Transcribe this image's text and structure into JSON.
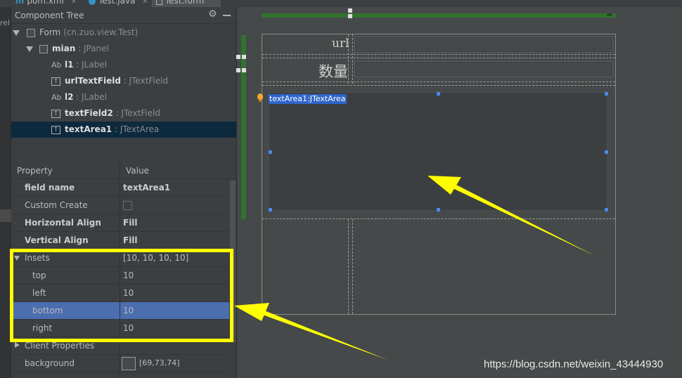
{
  "tabs": [
    {
      "label": "pom.xml",
      "icon": "maven-icon"
    },
    {
      "label": "Test.java",
      "icon": "java-class-icon"
    },
    {
      "label": "Test.form",
      "icon": "form-icon"
    }
  ],
  "left_strip_text": "rel",
  "component_tree": {
    "title": "Component Tree",
    "items": [
      {
        "name": "Form",
        "type": "(cn.zuo.view.Test)",
        "expanded": true,
        "has_checkbox": true
      },
      {
        "name": "mian",
        "type": ": JPanel",
        "expanded": true,
        "has_checkbox": true
      },
      {
        "icon_text": "Ab",
        "name": "l1",
        "type": ": JLabel"
      },
      {
        "icon_text": "T",
        "name": "urlTextField",
        "type": ": JTextField"
      },
      {
        "icon_text": "Ab",
        "name": "l2",
        "type": ": JLabel"
      },
      {
        "icon_text": "T",
        "name": "textField2",
        "type": ": JTextField"
      },
      {
        "icon_text": "T",
        "name": "textArea1",
        "type": ": JTextArea",
        "selected": true
      }
    ]
  },
  "properties": {
    "header_property": "Property",
    "header_value": "Value",
    "rows": [
      {
        "name": "field name",
        "value": "textArea1",
        "bold": true
      },
      {
        "name": "Custom Create",
        "value": "",
        "checkbox": true
      },
      {
        "name": "Horizontal Align",
        "value": "Fill",
        "bold": true
      },
      {
        "name": "Vertical Align",
        "value": "Fill",
        "bold": true
      },
      {
        "name": "Insets",
        "value": "[10, 10, 10, 10]",
        "expandable": "expanded"
      },
      {
        "name": "top",
        "value": "10",
        "indent": true
      },
      {
        "name": "left",
        "value": "10",
        "indent": true
      },
      {
        "name": "bottom",
        "value": "10",
        "indent": true,
        "selected": true
      },
      {
        "name": "right",
        "value": "10",
        "indent": true
      },
      {
        "name": "Client Properties",
        "value": "",
        "expandable": "collapsed"
      },
      {
        "name": "background",
        "value": "[69,73,74]",
        "swatch": "#45494a"
      }
    ]
  },
  "designer": {
    "label_url": "url",
    "label_qty": "数量",
    "textarea_caption": "textArea1:JTextArea"
  },
  "colors": {
    "highlight_yellow": "#ffff00",
    "selection_blue": "#4b6eaf",
    "tree_selection": "#0d293e",
    "layout_green": "#31722f"
  },
  "watermark": "https://blog.csdn.net/weixin_43444930"
}
